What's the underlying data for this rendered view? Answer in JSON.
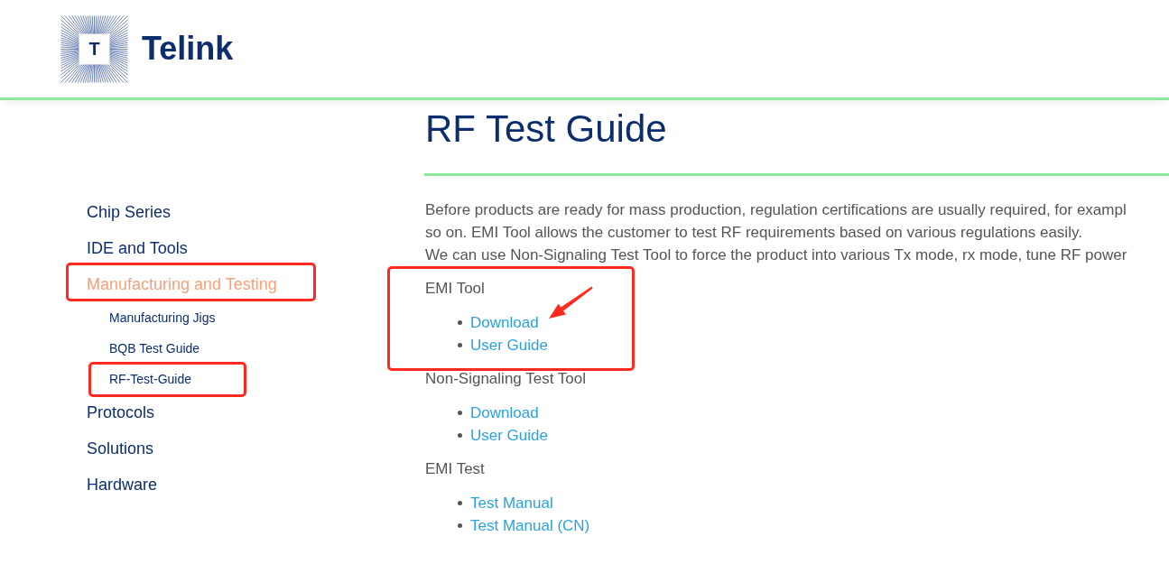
{
  "header": {
    "logo": {
      "mark": "T",
      "name": "Telink"
    }
  },
  "sidebar": {
    "items": [
      {
        "label": "Chip Series",
        "selected": false,
        "highlighted": false
      },
      {
        "label": "IDE and Tools",
        "selected": false,
        "highlighted": false
      },
      {
        "label": "Manufacturing and Testing",
        "selected": true,
        "highlighted": true,
        "children": [
          {
            "label": "Manufacturing Jigs",
            "selected": false,
            "highlighted": false
          },
          {
            "label": "BQB Test Guide",
            "selected": false,
            "highlighted": false
          },
          {
            "label": "RF-Test-Guide",
            "selected": false,
            "highlighted": true
          }
        ]
      },
      {
        "label": "Protocols",
        "selected": false,
        "highlighted": false
      },
      {
        "label": "Solutions",
        "selected": false,
        "highlighted": false
      },
      {
        "label": "Hardware",
        "selected": false,
        "highlighted": false
      }
    ]
  },
  "main": {
    "title": "RF Test Guide",
    "intro_lines": [
      "Before products are ready for mass production, regulation certifications are usually required, for exampl",
      "so on. EMI Tool allows the customer to test RF requirements based on various regulations easily.",
      "We can use Non-Signaling Test Tool to force the product into various Tx mode, rx mode, tune RF power"
    ],
    "sections": [
      {
        "heading": "EMI Tool",
        "highlighted": true,
        "links": [
          {
            "label": "Download",
            "arrow": true
          },
          {
            "label": "User Guide",
            "arrow": false
          }
        ]
      },
      {
        "heading": "Non-Signaling Test Tool",
        "highlighted": false,
        "links": [
          {
            "label": "Download",
            "arrow": false
          },
          {
            "label": "User Guide",
            "arrow": false
          }
        ]
      },
      {
        "heading": "EMI Test",
        "highlighted": false,
        "links": [
          {
            "label": "Test Manual",
            "arrow": false
          },
          {
            "label": "Test Manual (CN)",
            "arrow": false
          }
        ]
      }
    ]
  }
}
